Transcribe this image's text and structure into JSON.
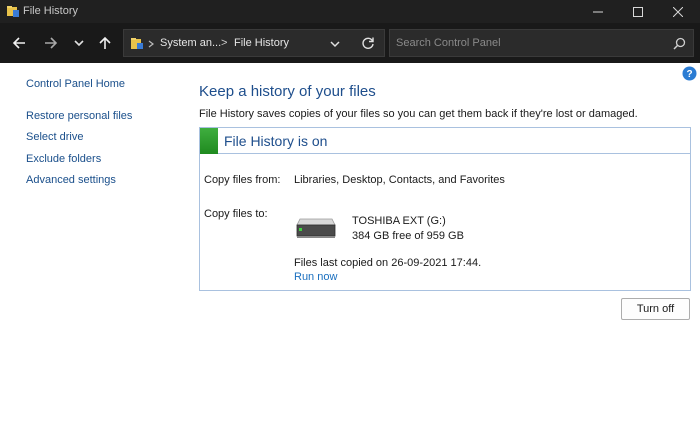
{
  "window": {
    "title": "File History",
    "minimize_icon": "minimize-icon",
    "maximize_icon": "maximize-icon",
    "close_icon": "close-icon"
  },
  "nav": {
    "breadcrumb": [
      "System an...",
      "File History"
    ],
    "breadcrumb_separator": ">",
    "search_placeholder": "Search Control Panel"
  },
  "sidebar": {
    "items": [
      {
        "label": "Control Panel Home"
      },
      {
        "label": "Restore personal files"
      },
      {
        "label": "Select drive"
      },
      {
        "label": "Exclude folders"
      },
      {
        "label": "Advanced settings"
      }
    ]
  },
  "main": {
    "title": "Keep a history of your files",
    "description": "File History saves copies of your files so you can get them back if they're lost or damaged.",
    "status": "File History is on",
    "status_color": "#2e9b2e",
    "copy_from_label": "Copy files from:",
    "copy_from_value": "Libraries, Desktop, Contacts, and Favorites",
    "copy_to_label": "Copy files to:",
    "drive_name": "TOSHIBA EXT (G:)",
    "drive_space": "384 GB free of 959 GB",
    "last_copied": "Files last copied on 26-09-2021 17:44.",
    "run_now": "Run now",
    "turn_off": "Turn off"
  },
  "colors": {
    "titlebar_bg": "#202020",
    "navbar_bg": "#191919",
    "link": "#1a4f8b",
    "heading": "#1e4e8c",
    "panel_border": "#a9c1df"
  }
}
